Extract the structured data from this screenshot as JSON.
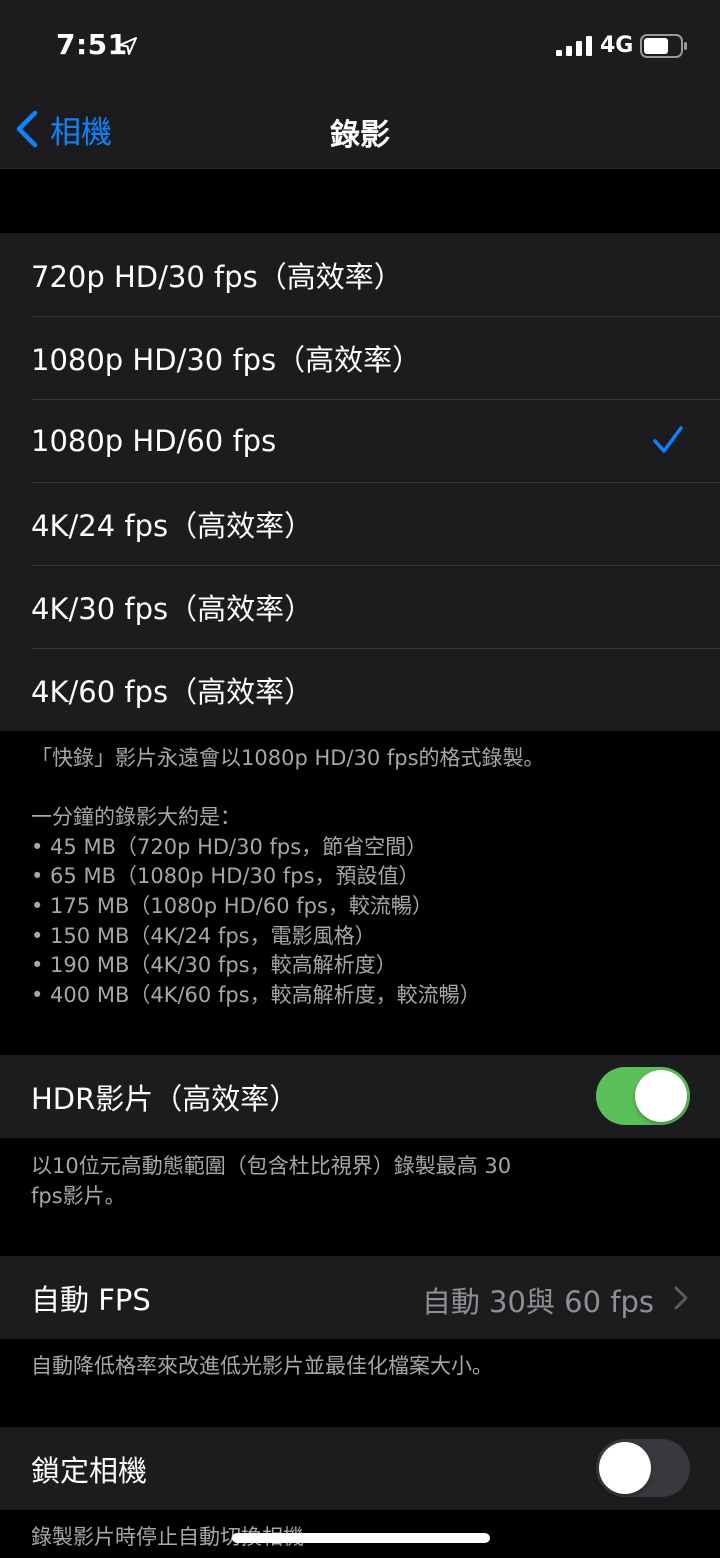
{
  "status_bar": {
    "time": "7:51",
    "network": "4G"
  },
  "nav": {
    "back_label": "相機",
    "title": "錄影"
  },
  "video_formats": [
    {
      "label": "720p HD/30 fps（高效率）",
      "selected": false
    },
    {
      "label": "1080p HD/30 fps（高效率）",
      "selected": false
    },
    {
      "label": "1080p HD/60 fps",
      "selected": true
    },
    {
      "label": "4K/24 fps（高效率）",
      "selected": false
    },
    {
      "label": "4K/30 fps（高效率）",
      "selected": false
    },
    {
      "label": "4K/60 fps（高效率）",
      "selected": false
    }
  ],
  "format_footer": {
    "quicktake_note": "「快錄」影片永遠會以1080p HD/30 fps的格式錄製。",
    "size_intro": "一分鐘的錄影大約是：",
    "sizes": [
      "• 45 MB（720p HD/30 fps，節省空間）",
      "• 65 MB（1080p HD/30 fps，預設值）",
      "• 175 MB（1080p HD/60 fps，較流暢）",
      "• 150 MB（4K/24 fps，電影風格）",
      "• 190 MB（4K/30 fps，較高解析度）",
      "• 400 MB（4K/60 fps，較高解析度，較流暢）"
    ]
  },
  "hdr": {
    "label": "HDR影片（高效率）",
    "enabled": true,
    "footer_line1": "以10位元高動態範圍（包含杜比視界）錄製最高 30",
    "footer_line2": "fps影片。"
  },
  "auto_fps": {
    "label": "自動 FPS",
    "value": "自動 30與 60 fps",
    "footer": "自動降低格率來改進低光影片並最佳化檔案大小。"
  },
  "lock_camera": {
    "label": "鎖定相機",
    "enabled": false,
    "footer": "錄製影片時停止自動切換相機"
  },
  "colors": {
    "accent": "#0a84ff",
    "toggle_on": "#5ac05a",
    "background": "#000000",
    "cell": "#1c1c1e",
    "secondary_text": "#a6a6ab"
  },
  "icons": {
    "location": "location-arrow-icon",
    "signal": "cellular-signal-icon",
    "battery": "battery-icon",
    "back": "chevron-left-icon",
    "check": "checkmark-icon",
    "disclosure": "chevron-right-icon"
  }
}
